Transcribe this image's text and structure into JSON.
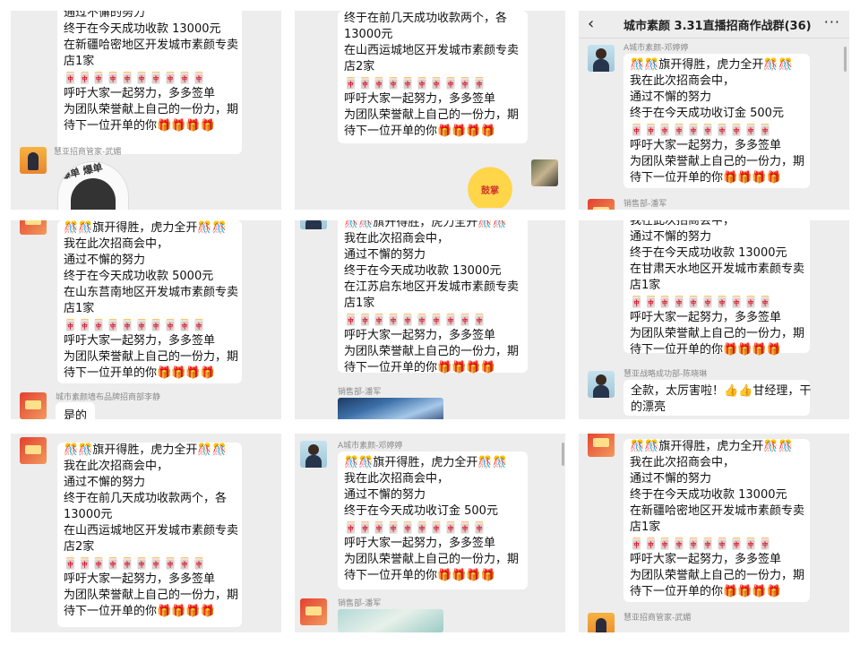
{
  "title": "城市素颜 3.31直播招商作战群(36)",
  "t1": {
    "lines": [
      "通过不懈的努力",
      "终于在今天成功收款 13000元",
      "在新疆哈密地区开发城市素颜专卖",
      "店1家",
      "🀄🀄🀄🀄🀄🀄🀄🀄🀄🀄",
      "呼吁大家一起努力，多多签单",
      "为团队荣誉献上自己的一份力，期",
      "待下一位开单的你🎁🎁🎁🎁"
    ],
    "sender": "慧亚招商管家-武媚",
    "sticker_text": "爆单 爆单"
  },
  "t2": {
    "lines": [
      "终于在前几天成功收款两个，各",
      "13000元",
      "在山西运城地区开发城市素颜专卖",
      "店2家",
      "🀄🀄🀄🀄🀄🀄🀄🀄🀄🀄",
      "呼吁大家一起努力，多多签单",
      "为团队荣誉献上自己的一份力，期",
      "待下一位开单的你🎁🎁🎁🎁"
    ],
    "sticker_text": "鼓掌"
  },
  "t3": {
    "sender": "A城市素颜-邓婷婷",
    "lines": [
      "🎊🎊旗开得胜，虎力全开🎊🎊",
      "我在此次招商会中，",
      "通过不懈的努力",
      "终于在今天成功收订金 500元",
      "🀄🀄🀄🀄🀄🀄🀄🀄🀄🀄",
      "呼吁大家一起努力，多多签单",
      "为团队荣誉献上自己的一份力，期",
      "待下一位开单的你🎁🎁🎁🎁"
    ],
    "sender2": "销售部-潘军"
  },
  "t4": {
    "lines": [
      "🎊🎊旗开得胜，虎力全开🎊🎊",
      "我在此次招商会中，",
      "通过不懈的努力",
      "终于在今天成功收款 5000元",
      "在山东莒南地区开发城市素颜专卖",
      "店1家",
      "🀄🀄🀄🀄🀄🀄🀄🀄🀄🀄",
      "呼吁大家一起努力，多多签单",
      "为团队荣誉献上自己的一份力，期",
      "待下一位开单的你🎁🎁🎁🎁"
    ],
    "sender": "城市素颜墙布品牌招商部李静",
    "reply": "是的"
  },
  "t5": {
    "lines": [
      "🎊🎊旗开得胜，虎力全开🎊🎊",
      "我在此次招商会中，",
      "通过不懈的努力",
      "终于在今天成功收款 13000元",
      "在江苏启东地区开发城市素颜专卖",
      "店1家",
      "🀄🀄🀄🀄🀄🀄🀄🀄🀄🀄",
      "呼吁大家一起努力，多多签单",
      "为团队荣誉献上自己的一份力，期",
      "待下一位开单的你🎁🎁🎁🎁"
    ],
    "sender": "销售部-潘军"
  },
  "t6": {
    "lines": [
      "我在此次招商会中，",
      "通过不懈的努力",
      "终于在今天成功收款 13000元",
      "在甘肃天水地区开发城市素颜专卖",
      "店1家",
      "🀄🀄🀄🀄🀄🀄🀄🀄🀄🀄",
      "呼吁大家一起努力，多多签单",
      "为团队荣誉献上自己的一份力，期",
      "待下一位开单的你🎁🎁🎁🎁"
    ],
    "sender": "慧亚战略成功部-陈晓琳",
    "reply_1": "全款，太厉害啦！👍👍甘经理，干",
    "reply_2": "的漂亮"
  },
  "t7": {
    "lines": [
      "🎊🎊旗开得胜，虎力全开🎊🎊",
      "我在此次招商会中，",
      "通过不懈的努力",
      "终于在前几天成功收款两个，各",
      "13000元",
      "在山西运城地区开发城市素颜专卖",
      "店2家",
      "🀄🀄🀄🀄🀄🀄🀄🀄🀄🀄",
      "呼吁大家一起努力，多多签单",
      "为团队荣誉献上自己的一份力，期",
      "待下一位开单的你🎁🎁🎁🎁"
    ]
  },
  "t8": {
    "sender": "A城市素颜-邓婷婷",
    "lines": [
      "🎊🎊旗开得胜，虎力全开🎊🎊",
      "我在此次招商会中，",
      "通过不懈的努力",
      "终于在今天成功收订金 500元",
      "🀄🀄🀄🀄🀄🀄🀄🀄🀄🀄",
      "呼吁大家一起努力，多多签单",
      "为团队荣誉献上自己的一份力，期",
      "待下一位开单的你🎁🎁🎁🎁"
    ],
    "sender2": "销售部-潘军"
  },
  "t9": {
    "lines": [
      "🎊🎊旗开得胜，虎力全开🎊🎊",
      "我在此次招商会中，",
      "通过不懈的努力",
      "终于在今天成功收款 13000元",
      "在新疆哈密地区开发城市素颜专卖",
      "店1家",
      "🀄🀄🀄🀄🀄🀄🀄🀄🀄🀄",
      "呼吁大家一起努力，多多签单",
      "为团队荣誉献上自己的一份力，期",
      "待下一位开单的你🎁🎁🎁🎁"
    ],
    "sender": "慧亚招商管家-武媚"
  },
  "icons": {
    "back": "chevron-left-icon",
    "more": "more-dots-icon"
  }
}
